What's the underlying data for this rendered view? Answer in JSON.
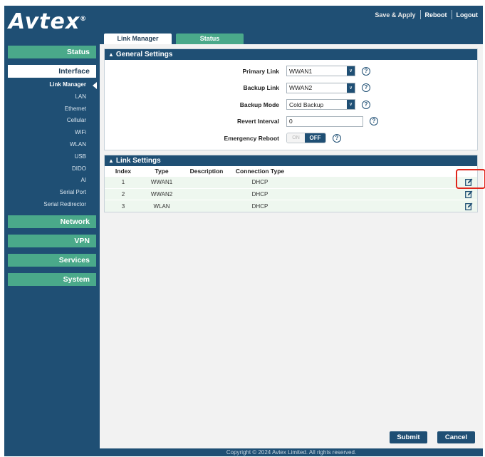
{
  "brand": {
    "logo_text": "Avtex",
    "logo_mark": "®"
  },
  "top_actions": [
    "Save & Apply",
    "Reboot",
    "Logout"
  ],
  "tabs": [
    {
      "label": "Link Manager",
      "active": true
    },
    {
      "label": "Status",
      "active": false
    }
  ],
  "sidebar": {
    "status": "Status",
    "interface": "Interface",
    "interface_items": [
      "Link Manager",
      "LAN",
      "Ethernet",
      "Cellular",
      "WiFi",
      "WLAN",
      "USB",
      "DIDO",
      "AI",
      "Serial Port",
      "Serial Redirector"
    ],
    "network": "Network",
    "vpn": "VPN",
    "services": "Services",
    "system": "System"
  },
  "general": {
    "title": "General Settings",
    "primary_link": {
      "label": "Primary Link",
      "value": "WWAN1"
    },
    "backup_link": {
      "label": "Backup Link",
      "value": "WWAN2"
    },
    "backup_mode": {
      "label": "Backup Mode",
      "value": "Cold Backup"
    },
    "revert_interval": {
      "label": "Revert Interval",
      "value": "0"
    },
    "emergency_reboot": {
      "label": "Emergency Reboot",
      "on_label": "ON",
      "off_label": "OFF",
      "state": "OFF"
    }
  },
  "link_settings": {
    "title": "Link Settings",
    "columns": [
      "Index",
      "Type",
      "Description",
      "Connection Type"
    ],
    "rows": [
      [
        "1",
        "WWAN1",
        "",
        "DHCP"
      ],
      [
        "2",
        "WWAN2",
        "",
        "DHCP"
      ],
      [
        "3",
        "WLAN",
        "",
        "DHCP"
      ]
    ]
  },
  "buttons": {
    "submit": "Submit",
    "cancel": "Cancel"
  },
  "footer": "Copyright © 2024 Avtex Limited. All rights reserved.",
  "colors": {
    "primary": "#1f4f74",
    "accent": "#4aa98a",
    "highlight": "#e0251b"
  },
  "icons": {
    "help": "question-circle-icon",
    "edit": "edit-pencil-icon",
    "dropdown": "chevron-down-icon"
  }
}
